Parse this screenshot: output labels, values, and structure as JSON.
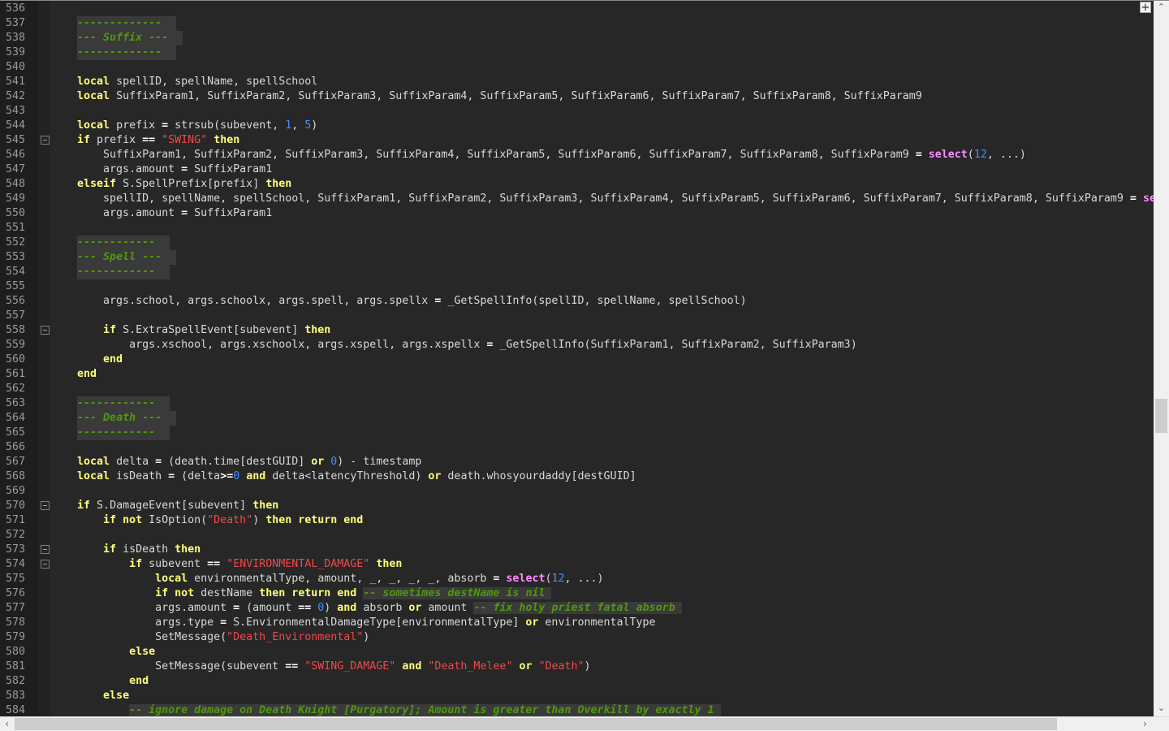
{
  "editor": {
    "theme_colors": {
      "background": "#272727",
      "keyword": "#ffff7a",
      "string": "#f04848",
      "number": "#3f8fff",
      "function": "#ff8cff",
      "comment": "#4e9a0a",
      "comment_bg": "#3a3a3a",
      "text": "#d8d8d8"
    },
    "zoom_button_label": "+",
    "scroll_up_icon": "chevron-up-icon",
    "scroll_down_icon": "chevron-down-icon",
    "scroll_left_icon": "chevron-left-icon",
    "scroll_right_icon": "chevron-right-icon",
    "glyphs": {
      "up": "⌃",
      "down": "⌄",
      "left": "‹",
      "right": "›"
    }
  },
  "lines": [
    {
      "num": "536",
      "tokens": []
    },
    {
      "num": "537",
      "tokens": [
        [
          "t",
          "    "
        ],
        [
          "h",
          "-------------"
        ]
      ]
    },
    {
      "num": "538",
      "tokens": [
        [
          "t",
          "    "
        ],
        [
          "h",
          "--- Suffix ---"
        ]
      ]
    },
    {
      "num": "539",
      "tokens": [
        [
          "t",
          "    "
        ],
        [
          "h",
          "-------------"
        ]
      ]
    },
    {
      "num": "540",
      "tokens": []
    },
    {
      "num": "541",
      "tokens": [
        [
          "t",
          "    "
        ],
        [
          "k",
          "local"
        ],
        [
          "t",
          " spellID, spellName, spellSchool"
        ]
      ]
    },
    {
      "num": "542",
      "tokens": [
        [
          "t",
          "    "
        ],
        [
          "k",
          "local"
        ],
        [
          "t",
          " SuffixParam1, SuffixParam2, SuffixParam3, SuffixParam4, SuffixParam5, SuffixParam6, SuffixParam7, SuffixParam8, SuffixParam9"
        ]
      ]
    },
    {
      "num": "543",
      "tokens": []
    },
    {
      "num": "544",
      "tokens": [
        [
          "t",
          "    "
        ],
        [
          "k",
          "local"
        ],
        [
          "t",
          " prefix "
        ],
        [
          "o",
          "="
        ],
        [
          "t",
          " strsub(subevent, "
        ],
        [
          "n",
          "1"
        ],
        [
          "t",
          ", "
        ],
        [
          "n",
          "5"
        ],
        [
          "t",
          ")"
        ]
      ]
    },
    {
      "num": "545",
      "tokens": [
        [
          "t",
          "    "
        ],
        [
          "k",
          "if"
        ],
        [
          "t",
          " prefix "
        ],
        [
          "o",
          "=="
        ],
        [
          "t",
          " "
        ],
        [
          "s",
          "\"SWING\""
        ],
        [
          "t",
          " "
        ],
        [
          "k",
          "then"
        ]
      ]
    },
    {
      "num": "546",
      "tokens": [
        [
          "t",
          "        SuffixParam1, SuffixParam2, SuffixParam3, SuffixParam4, SuffixParam5, SuffixParam6, SuffixParam7, SuffixParam8, SuffixParam9 "
        ],
        [
          "o",
          "="
        ],
        [
          "t",
          " "
        ],
        [
          "f",
          "select"
        ],
        [
          "t",
          "("
        ],
        [
          "n",
          "12"
        ],
        [
          "t",
          ", ...)"
        ]
      ]
    },
    {
      "num": "547",
      "tokens": [
        [
          "t",
          "        args.amount "
        ],
        [
          "o",
          "="
        ],
        [
          "t",
          " SuffixParam1"
        ]
      ]
    },
    {
      "num": "548",
      "tokens": [
        [
          "t",
          "    "
        ],
        [
          "k",
          "elseif"
        ],
        [
          "t",
          " S.SpellPrefix[prefix] "
        ],
        [
          "k",
          "then"
        ]
      ]
    },
    {
      "num": "549",
      "tokens": [
        [
          "t",
          "        spellID, spellName, spellSchool, SuffixParam1, SuffixParam2, SuffixParam3, SuffixParam4, SuffixParam5, SuffixParam6, SuffixParam7, SuffixParam8, SuffixParam9 "
        ],
        [
          "o",
          "="
        ],
        [
          "t",
          " "
        ],
        [
          "f",
          "se"
        ]
      ]
    },
    {
      "num": "550",
      "tokens": [
        [
          "t",
          "        args.amount "
        ],
        [
          "o",
          "="
        ],
        [
          "t",
          " SuffixParam1"
        ]
      ]
    },
    {
      "num": "551",
      "tokens": []
    },
    {
      "num": "552",
      "tokens": [
        [
          "t",
          "    "
        ],
        [
          "h",
          "------------"
        ]
      ]
    },
    {
      "num": "553",
      "tokens": [
        [
          "t",
          "    "
        ],
        [
          "h",
          "--- Spell ---"
        ]
      ]
    },
    {
      "num": "554",
      "tokens": [
        [
          "t",
          "    "
        ],
        [
          "h",
          "------------"
        ]
      ]
    },
    {
      "num": "555",
      "tokens": []
    },
    {
      "num": "556",
      "tokens": [
        [
          "t",
          "        args.school, args.schoolx, args.spell, args.spellx "
        ],
        [
          "o",
          "="
        ],
        [
          "t",
          " _GetSpellInfo(spellID, spellName, spellSchool)"
        ]
      ]
    },
    {
      "num": "557",
      "tokens": []
    },
    {
      "num": "558",
      "tokens": [
        [
          "t",
          "        "
        ],
        [
          "k",
          "if"
        ],
        [
          "t",
          " S.ExtraSpellEvent[subevent] "
        ],
        [
          "k",
          "then"
        ]
      ]
    },
    {
      "num": "559",
      "tokens": [
        [
          "t",
          "            args.xschool, args.xschoolx, args.xspell, args.xspellx "
        ],
        [
          "o",
          "="
        ],
        [
          "t",
          " _GetSpellInfo(SuffixParam1, SuffixParam2, SuffixParam3)"
        ]
      ]
    },
    {
      "num": "560",
      "tokens": [
        [
          "t",
          "        "
        ],
        [
          "k",
          "end"
        ]
      ]
    },
    {
      "num": "561",
      "tokens": [
        [
          "t",
          "    "
        ],
        [
          "k",
          "end"
        ]
      ]
    },
    {
      "num": "562",
      "tokens": []
    },
    {
      "num": "563",
      "tokens": [
        [
          "t",
          "    "
        ],
        [
          "h",
          "------------"
        ]
      ]
    },
    {
      "num": "564",
      "tokens": [
        [
          "t",
          "    "
        ],
        [
          "h",
          "--- Death ---"
        ]
      ]
    },
    {
      "num": "565",
      "tokens": [
        [
          "t",
          "    "
        ],
        [
          "h",
          "------------"
        ]
      ]
    },
    {
      "num": "566",
      "tokens": []
    },
    {
      "num": "567",
      "tokens": [
        [
          "t",
          "    "
        ],
        [
          "k",
          "local"
        ],
        [
          "t",
          " delta "
        ],
        [
          "o",
          "="
        ],
        [
          "t",
          " (death.time[destGUID] "
        ],
        [
          "k",
          "or"
        ],
        [
          "t",
          " "
        ],
        [
          "n",
          "0"
        ],
        [
          "t",
          ") - timestamp"
        ]
      ]
    },
    {
      "num": "568",
      "tokens": [
        [
          "t",
          "    "
        ],
        [
          "k",
          "local"
        ],
        [
          "t",
          " isDeath "
        ],
        [
          "o",
          "="
        ],
        [
          "t",
          " (delta"
        ],
        [
          "o",
          ">="
        ],
        [
          "n",
          "0"
        ],
        [
          "t",
          " "
        ],
        [
          "k",
          "and"
        ],
        [
          "t",
          " delta<latencyThreshold) "
        ],
        [
          "k",
          "or"
        ],
        [
          "t",
          " death.whosyourdaddy[destGUID]"
        ]
      ]
    },
    {
      "num": "569",
      "tokens": []
    },
    {
      "num": "570",
      "tokens": [
        [
          "t",
          "    "
        ],
        [
          "k",
          "if"
        ],
        [
          "t",
          " S.DamageEvent[subevent] "
        ],
        [
          "k",
          "then"
        ]
      ]
    },
    {
      "num": "571",
      "tokens": [
        [
          "t",
          "        "
        ],
        [
          "k",
          "if not"
        ],
        [
          "t",
          " IsOption("
        ],
        [
          "s",
          "\"Death\""
        ],
        [
          "t",
          ") "
        ],
        [
          "k",
          "then return end"
        ]
      ]
    },
    {
      "num": "572",
      "tokens": []
    },
    {
      "num": "573",
      "tokens": [
        [
          "t",
          "        "
        ],
        [
          "k",
          "if"
        ],
        [
          "t",
          " isDeath "
        ],
        [
          "k",
          "then"
        ]
      ]
    },
    {
      "num": "574",
      "tokens": [
        [
          "t",
          "            "
        ],
        [
          "k",
          "if"
        ],
        [
          "t",
          " subevent "
        ],
        [
          "o",
          "=="
        ],
        [
          "t",
          " "
        ],
        [
          "s",
          "\"ENVIRONMENTAL_DAMAGE\""
        ],
        [
          "t",
          " "
        ],
        [
          "k",
          "then"
        ]
      ]
    },
    {
      "num": "575",
      "tokens": [
        [
          "t",
          "                "
        ],
        [
          "k",
          "local"
        ],
        [
          "t",
          " environmentalType, amount, _, _, _, _, absorb "
        ],
        [
          "o",
          "="
        ],
        [
          "t",
          " "
        ],
        [
          "f",
          "select"
        ],
        [
          "t",
          "("
        ],
        [
          "n",
          "12"
        ],
        [
          "t",
          ", ...)"
        ]
      ]
    },
    {
      "num": "576",
      "tokens": [
        [
          "t",
          "                "
        ],
        [
          "k",
          "if not"
        ],
        [
          "t",
          " destName "
        ],
        [
          "k",
          "then return end"
        ],
        [
          "t",
          " "
        ],
        [
          "c",
          "-- sometimes destName is nil"
        ]
      ]
    },
    {
      "num": "577",
      "tokens": [
        [
          "t",
          "                args.amount "
        ],
        [
          "o",
          "="
        ],
        [
          "t",
          " (amount "
        ],
        [
          "o",
          "=="
        ],
        [
          "t",
          " "
        ],
        [
          "n",
          "0"
        ],
        [
          "t",
          ") "
        ],
        [
          "k",
          "and"
        ],
        [
          "t",
          " absorb "
        ],
        [
          "k",
          "or"
        ],
        [
          "t",
          " amount "
        ],
        [
          "c",
          "-- fix holy priest fatal absorb"
        ]
      ]
    },
    {
      "num": "578",
      "tokens": [
        [
          "t",
          "                args.type "
        ],
        [
          "o",
          "="
        ],
        [
          "t",
          " S.EnvironmentalDamageType[environmentalType] "
        ],
        [
          "k",
          "or"
        ],
        [
          "t",
          " environmentalType"
        ]
      ]
    },
    {
      "num": "579",
      "tokens": [
        [
          "t",
          "                SetMessage("
        ],
        [
          "s",
          "\"Death_Environmental\""
        ],
        [
          "t",
          ")"
        ]
      ]
    },
    {
      "num": "580",
      "tokens": [
        [
          "t",
          "            "
        ],
        [
          "k",
          "else"
        ]
      ]
    },
    {
      "num": "581",
      "tokens": [
        [
          "t",
          "                SetMessage(subevent "
        ],
        [
          "o",
          "=="
        ],
        [
          "t",
          " "
        ],
        [
          "s",
          "\"SWING_DAMAGE\""
        ],
        [
          "t",
          " "
        ],
        [
          "k",
          "and"
        ],
        [
          "t",
          " "
        ],
        [
          "s",
          "\"Death_Melee\""
        ],
        [
          "t",
          " "
        ],
        [
          "k",
          "or"
        ],
        [
          "t",
          " "
        ],
        [
          "s",
          "\"Death\""
        ],
        [
          "t",
          ")"
        ]
      ]
    },
    {
      "num": "582",
      "tokens": [
        [
          "t",
          "            "
        ],
        [
          "k",
          "end"
        ]
      ]
    },
    {
      "num": "583",
      "tokens": [
        [
          "t",
          "        "
        ],
        [
          "k",
          "else"
        ]
      ]
    },
    {
      "num": "584",
      "tokens": [
        [
          "t",
          "            "
        ],
        [
          "c",
          "-- ignore damage on Death Knight [Purgatory]; Amount is greater than Overkill by exactly 1"
        ]
      ]
    }
  ]
}
